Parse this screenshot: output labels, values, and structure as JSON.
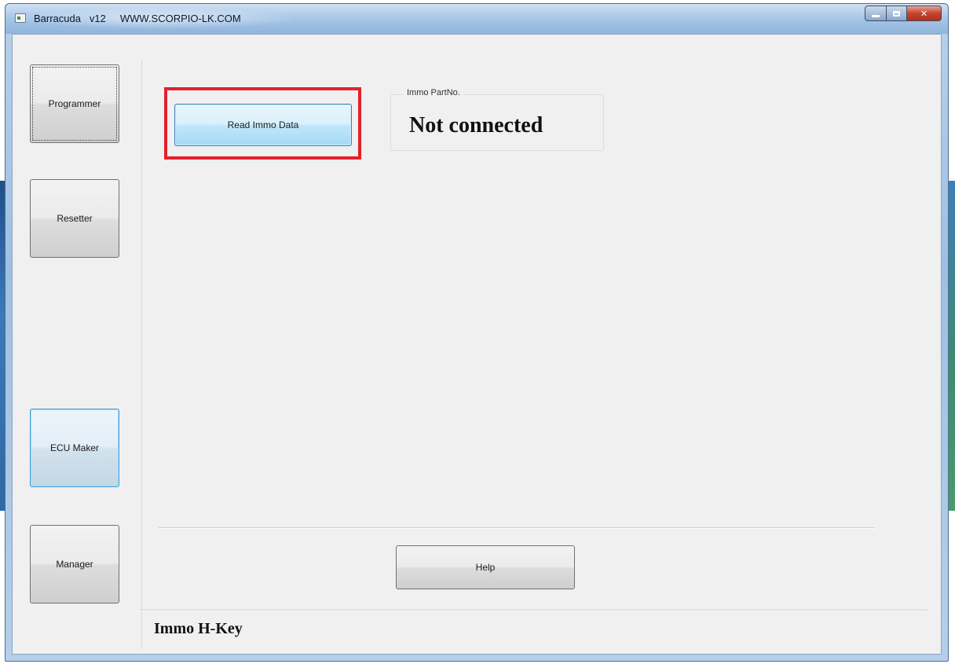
{
  "window": {
    "title": "Barracuda   v12     WWW.SCORPIO-LK.COM"
  },
  "sidebar": {
    "items": [
      {
        "label": "Programmer"
      },
      {
        "label": "Resetter"
      },
      {
        "label": "ECU Maker"
      },
      {
        "label": "Manager"
      }
    ]
  },
  "main": {
    "read_button_label": "Read Immo Data",
    "immo_group_caption": "Immo PartNo.",
    "status_text": "Not connected",
    "help_button_label": "Help"
  },
  "footer": {
    "label": "Immo H-Key"
  },
  "colors": {
    "highlight": "#e4202a",
    "active_border": "#3c9fd6"
  },
  "icons": {
    "app": "app-icon",
    "minimize": "minimize-icon",
    "maximize": "maximize-icon",
    "close": "close-icon"
  }
}
